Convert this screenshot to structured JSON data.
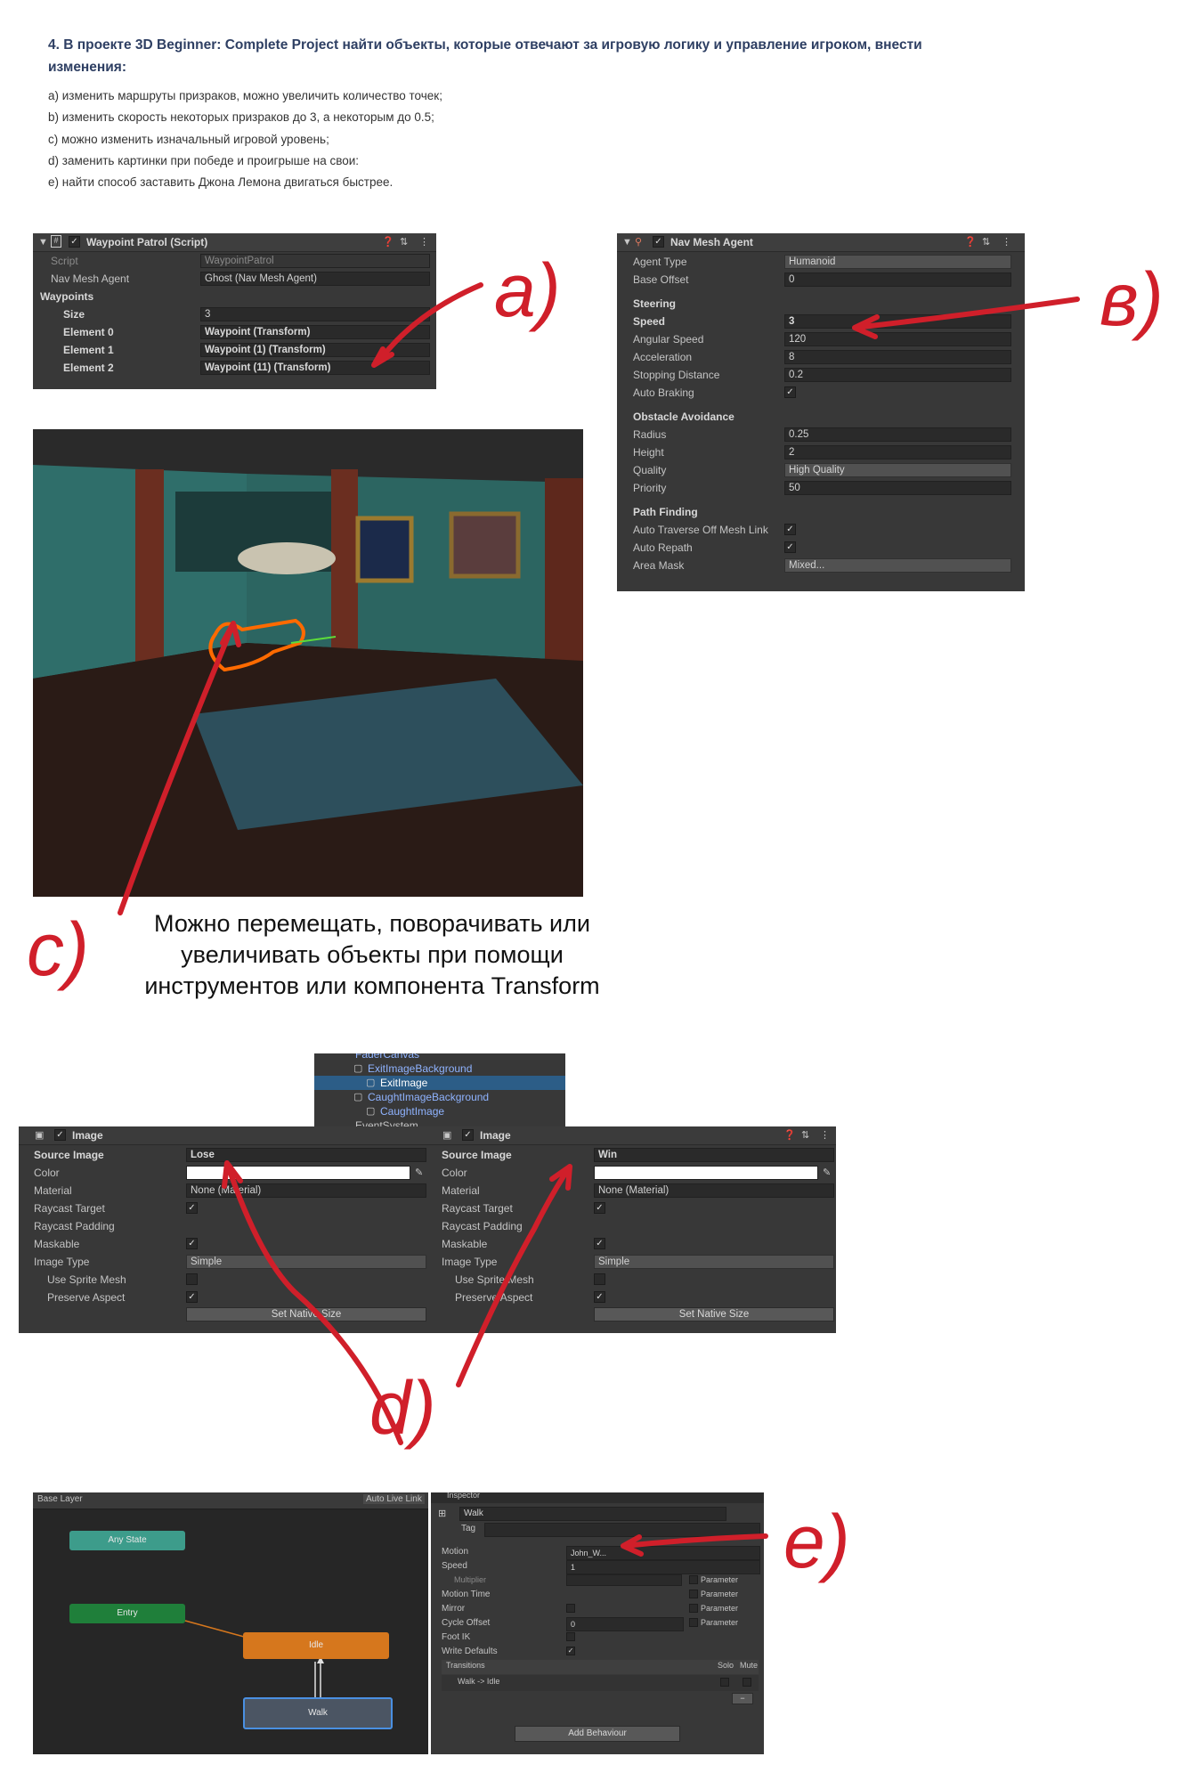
{
  "task": {
    "title": "4. В проекте 3D Beginner: Complete Project найти объекты, которые отвечают за игровую логику и управление игроком, внести изменения:",
    "items": [
      "а) изменить маршруты призраков, можно увеличить количество точек;",
      "b) изменить скорость некоторых призраков до 3, а некоторым до 0.5;",
      "c) можно изменить изначальный игровой уровень;",
      "d) заменить картинки при победе и проигрыше на свои:",
      "e) найти способ заставить Джона Лемона двигаться быстрее."
    ]
  },
  "waypoint_patrol": {
    "title": "Waypoint Patrol (Script)",
    "script_label": "Script",
    "script_value": "WaypointPatrol",
    "nav_label": "Nav Mesh Agent",
    "nav_value": "Ghost (Nav Mesh Agent)",
    "waypoints_label": "Waypoints",
    "size_label": "Size",
    "size_value": "3",
    "elements": [
      {
        "label": "Element 0",
        "value": "Waypoint (Transform)"
      },
      {
        "label": "Element 1",
        "value": "Waypoint (1) (Transform)"
      },
      {
        "label": "Element 2",
        "value": "Waypoint (11) (Transform)"
      }
    ]
  },
  "nav_mesh_agent": {
    "title": "Nav Mesh Agent",
    "agent_type_label": "Agent Type",
    "agent_type": "Humanoid",
    "base_offset_label": "Base Offset",
    "base_offset": "0",
    "steering": "Steering",
    "speed_label": "Speed",
    "speed": "3",
    "angular_label": "Angular Speed",
    "angular": "120",
    "accel_label": "Acceleration",
    "accel": "8",
    "stopping_label": "Stopping Distance",
    "stopping": "0.2",
    "auto_braking_label": "Auto Braking",
    "obstacle": "Obstacle Avoidance",
    "radius_label": "Radius",
    "radius": "0.25",
    "height_label": "Height",
    "height": "2",
    "quality_label": "Quality",
    "quality": "High Quality",
    "priority_label": "Priority",
    "priority": "50",
    "pathfinding": "Path Finding",
    "auto_traverse_label": "Auto Traverse Off Mesh Link",
    "auto_repath_label": "Auto Repath",
    "area_mask_label": "Area Mask",
    "area_mask": "Mixed..."
  },
  "caption_c": [
    "Можно перемещать, поворачивать или",
    "увеличивать объекты при помощи",
    "инструментов или компонента Transform"
  ],
  "hierarchy": {
    "items": [
      "FaderCanvas",
      "ExitImageBackground",
      "ExitImage",
      "CaughtImageBackground",
      "CaughtImage",
      "EventSystem"
    ]
  },
  "image_left": {
    "title": "Image",
    "source_label": "Source Image",
    "source": "Lose",
    "color_label": "Color",
    "material_label": "Material",
    "material": "None (Material)",
    "raycast_label": "Raycast Target",
    "padding_label": "Raycast Padding",
    "maskable_label": "Maskable",
    "type_label": "Image Type",
    "type": "Simple",
    "sprite_mesh_label": "Use Sprite Mesh",
    "preserve_label": "Preserve Aspect",
    "native_btn": "Set Native Size"
  },
  "image_right": {
    "title": "Image",
    "source_label": "Source Image",
    "source": "Win",
    "color_label": "Color",
    "material_label": "Material",
    "material": "None (Material)",
    "raycast_label": "Raycast Target",
    "padding_label": "Raycast Padding",
    "maskable_label": "Maskable",
    "type_label": "Image Type",
    "type": "Simple",
    "sprite_mesh_label": "Use Sprite Mesh",
    "preserve_label": "Preserve Aspect",
    "native_btn": "Set Native Size"
  },
  "animator": {
    "layer": "Base Layer",
    "live_link": "Auto Live Link",
    "any_state": "Any State",
    "entry": "Entry",
    "idle": "Idle",
    "walk": "Walk"
  },
  "state_inspector": {
    "tab": "Inspector",
    "name": "Walk",
    "tag_label": "Tag",
    "motion_label": "Motion",
    "motion": "John_W...",
    "speed_label": "Speed",
    "speed": "1",
    "multiplier_label": "Multiplier",
    "motion_time_label": "Motion Time",
    "mirror_label": "Mirror",
    "cycle_label": "Cycle Offset",
    "cycle": "0",
    "foot_ik_label": "Foot IK",
    "write_defaults_label": "Write Defaults",
    "parameter": "Parameter",
    "transitions_label": "Transitions",
    "solo": "Solo",
    "mute": "Mute",
    "transition": "Walk -> Idle",
    "add_behaviour": "Add Behaviour"
  },
  "annotations": {
    "a": "a)",
    "b": "в)",
    "c": "c)",
    "d": "d)",
    "e": "e)"
  },
  "colors": {
    "annotation_red": "#d01f2a",
    "unity_panel": "#383838",
    "title_blue": "#2e3f63",
    "idle_orange": "#d6771d",
    "entry_green": "#1f7f3a",
    "anystate_teal": "#3d9c8b"
  }
}
